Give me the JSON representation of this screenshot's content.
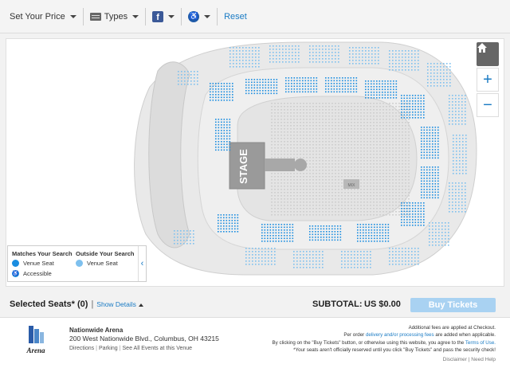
{
  "toolbar": {
    "price_label": "Set Your Price",
    "types_label": "Types",
    "facebook_letter": "f",
    "accessible_symbol": "♿",
    "reset_label": "Reset"
  },
  "map": {
    "stage_label": "STAGE",
    "mix_label": "MIX",
    "colors": {
      "seat_match": "#1a8de0",
      "seat_outside": "#7ec0ee",
      "section_fill": "#e6e6e6",
      "stage_fill": "#9a9a9a"
    },
    "zoom": {
      "home_icon": "home-icon",
      "in_symbol": "+",
      "out_symbol": "−"
    }
  },
  "legend": {
    "matches_title": "Matches Your Search",
    "matches_items": [
      "Venue Seat",
      "Accessible"
    ],
    "outside_title": "Outside Your Search",
    "outside_items": [
      "Venue Seat"
    ],
    "toggle_symbol": "‹"
  },
  "summary": {
    "selected_label": "Selected Seats* (0)",
    "separator": "|",
    "show_details": "Show Details",
    "subtotal_label": "SUBTOTAL:",
    "subtotal_value": "US $0.00",
    "buy_label": "Buy Tickets"
  },
  "venue": {
    "name": "Nationwide Arena",
    "address": "200 West Nationwide Blvd., Columbus, OH 43215",
    "links": [
      "Directions",
      "Parking",
      "See All Events at this Venue"
    ],
    "logo_text": "Arena"
  },
  "legal": {
    "line1": "Additional fees are applied at Checkout.",
    "line2_prefix": "Per order",
    "line2_link": "delivery and/or processing fees",
    "line2_suffix": "are added when applicable.",
    "line3_prefix": "By clicking on the \"Buy Tickets\" button, or otherwise using this website, you agree to the",
    "line3_link": "Terms of Use.",
    "line4": "*Your seats aren't officially reserved until you click \"Buy Tickets\" and pass the security check!",
    "disclaimer": "Disclaimer",
    "help": "Need Help"
  }
}
